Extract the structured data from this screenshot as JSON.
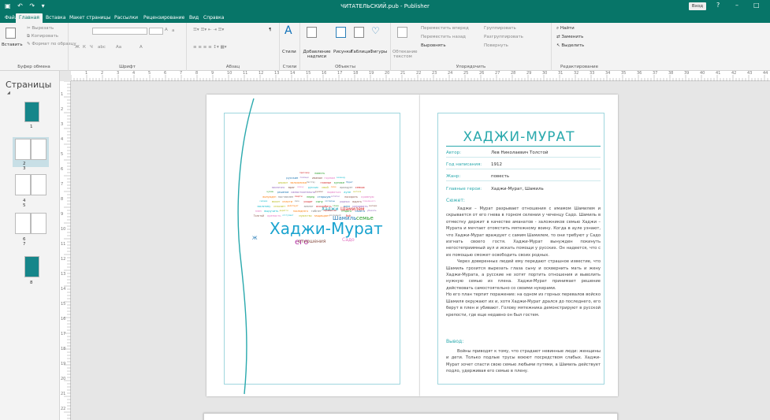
{
  "app": {
    "title": "ЧИТАТЕЛЬСКИЙ.pub - Publisher",
    "signin": "Вход",
    "help": "?",
    "minimize": "–",
    "restore": "□"
  },
  "tabs": [
    "Файл",
    "Главная",
    "Вставка",
    "Макет страницы",
    "Рассылки",
    "Рецензирование",
    "Вид",
    "Справка"
  ],
  "ribbon": {
    "clipboard": {
      "paste": "Вставить",
      "cut": "Вырезать",
      "copy": "Копировать",
      "format": "Формат по образцу",
      "label": "Буфер обмена"
    },
    "font": {
      "label": "Шрифт",
      "bold": "Ж",
      "italic": "К",
      "underline": "Ч",
      "strike": "abc",
      "size_up": "A",
      "size_down": "a",
      "case": "Aa",
      "color": "A"
    },
    "paragraph": {
      "label": "Абзац",
      "mark": "¶"
    },
    "styles": {
      "btn": "Стили",
      "label": "Стили"
    },
    "objects": {
      "textbox": "Добавление надписи",
      "pictures": "Рисунки",
      "table": "Таблица",
      "shapes": "Фигуры",
      "label": "Объекты"
    },
    "arrange": {
      "wrap": "Обтекание текстом",
      "forward": "Переместить вперед",
      "backward": "Переместить назад",
      "align": "Выровнять",
      "group": "Группировать",
      "ungroup": "Разгруппировать",
      "rotate": "Повернуть",
      "label": "Упорядочить"
    },
    "editing": {
      "find": "Найти",
      "replace": "Заменить",
      "select": "Выделить",
      "label": "Редактирование"
    }
  },
  "pages_pane": {
    "title": "Страницы",
    "thumbs": [
      {
        "label": "1"
      },
      {
        "label": "2 3"
      },
      {
        "label": "4 5"
      },
      {
        "label": "6 7"
      },
      {
        "label": "8"
      }
    ]
  },
  "ruler": {
    "h": [
      "1",
      "2",
      "3",
      "4",
      "5",
      "6",
      "7",
      "8",
      "9",
      "10",
      "11",
      "12",
      "13",
      "14",
      "15",
      "16",
      "17",
      "18",
      "19",
      "20",
      "21",
      "22",
      "23",
      "24",
      "25",
      "26",
      "27",
      "28",
      "29",
      "30",
      "31",
      "32",
      "33",
      "34",
      "35",
      "36",
      "37",
      "38",
      "39",
      "40",
      "41",
      "42",
      "43",
      "44",
      "45"
    ],
    "v": [
      "1",
      "2",
      "3",
      "4",
      "5",
      "6",
      "7",
      "8",
      "9",
      "10",
      "11",
      "12",
      "13",
      "14",
      "15",
      "16",
      "17",
      "18",
      "19",
      "20",
      "21",
      "22",
      "23"
    ]
  },
  "wordcloud": {
    "main": "Хаджи-Мурат",
    "big": [
      {
        "t": "его",
        "c": "#b02fa0"
      },
      {
        "t": "Шамиль",
        "c": "#1f77b4"
      },
      {
        "t": "семье",
        "c": "#2ca02c"
      },
      {
        "t": "Шамилем",
        "c": "#d62728"
      },
      {
        "t": "Хаджи",
        "c": "#17a2b8"
      },
      {
        "t": "отношения",
        "c": "#8c564b"
      },
      {
        "t": "Садо",
        "c": "#e377c2"
      },
      {
        "t": "Ж",
        "c": "#1f77b4"
      }
    ],
    "small": [
      "приговор",
      "повесть",
      "русские",
      "помощи",
      "имамом",
      "горном",
      "чеченцу",
      "держит",
      "заложника",
      "бегству",
      "главные",
      "кунаке",
      "Мурат",
      "заклятого",
      "враг",
      "воину",
      "русских",
      "свой",
      "свою",
      "враждует",
      "семью",
      "нужен",
      "решение",
      "самостоятельно",
      "руками",
      "вырваться",
      "ауле",
      "жителя",
      "вынужден",
      "поставлен",
      "смерти",
      "перед",
      "старшую",
      "остатки",
      "поссорить",
      "кровную",
      "силами",
      "может",
      "спасти",
      "свое",
      "уходит",
      "сыну",
      "согласны",
      "родных",
      "ждать",
      "пленённого",
      "заклятому",
      "спасает",
      "действует",
      "аманат",
      "оскорбить",
      "глаза",
      "жене",
      "разорвать",
      "матери",
      "плен",
      "выручить",
      "дерётся",
      "последнего",
      "гибнет",
      "перебежчик",
      "старого",
      "своего",
      "убежать",
      "Толстой",
      "крепость",
      "отступает",
      "мужество",
      "защищает",
      "последний",
      "бой"
    ]
  },
  "article": {
    "title": "ХАДЖИ-МУРАТ",
    "author_label": "Автор:",
    "author": "Лев Николаевич Толстой",
    "year_label": "Год написания:",
    "year": "1912",
    "genre_label": "Жанр:",
    "genre": "повесть",
    "heroes_label": "Главные герои:",
    "heroes": "Хаджи-Мурат, Шамиль",
    "plot_label": "Сюжет:",
    "plot_p1": "Хаджи – Мурат разрывает отношения с имамом Шамилем и скрывается от его гнева в горном селении у чеченцу Садо. Шамиль в отместку держит в качестве аманатов - заложников семью Хаджи – Мурата и мечтает отомстить мятежному воину. Когда в ауле узнают, что Хаджи-Мурат враждует с самим Шамилем, то они требуют у Садо изгнать своего гостя. Хаджи-Мурат вынужден покинуть негостеприимный аул и искать помощи у русских. Он надеется, что с их помощью сможет освободить своих родных.",
    "plot_p2": "Через доверенных людей ему передают страшное известие, что Шамиль грозится вырезать глаза сыну и осквернить мать и жену Хаджи-Мурата, а русские не хотят портить отношения и выволить нужную семью из плена. Хаджи-Мурат принимает решение действовать самостоятельно со своими нукерами.",
    "plot_p3": "Но его план терпит поражение: на одном из горных перевалов войско Шамиля окружают их и, хотя Хаджи-Мурат дрался до последнего, его берут в плен и убивают. Голову мятежника демонстрируют в русской крепости, где еще недавно он был гостем.",
    "conclusion_label": "Вывод:",
    "conclusion": "Войны приводят к тому, что страдают невинные люди: женщины и дети. Только подлые трусы воюют посредством слабых. Хаджи-Мурат хочет спасти свою семью любыми путями, а Шамиль действует подло, удерживая его семью в плену."
  },
  "colors": {
    "brand": "#077568",
    "accent": "#2aa9ad"
  }
}
